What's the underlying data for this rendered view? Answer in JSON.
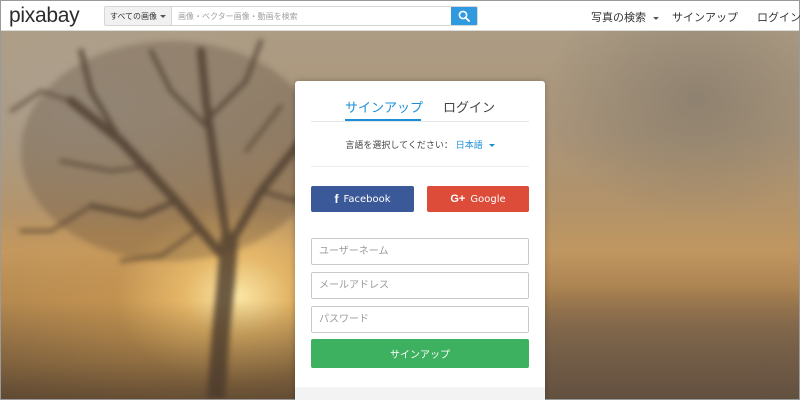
{
  "brand": {
    "logo_text": "pixabay"
  },
  "search": {
    "filter_label": "すべての画像",
    "placeholder": "画像・ベクター画像・動画を検索",
    "value": "",
    "button_icon": "search-icon"
  },
  "nav": {
    "photo_search": "写真の検索",
    "signup": "サインアップ",
    "login": "ログイン"
  },
  "panel": {
    "tabs": [
      {
        "label": "サインアップ",
        "active": true
      },
      {
        "label": "ログイン",
        "active": false
      }
    ],
    "language_prompt": "言語を選択してください：",
    "language_value": "日本語",
    "facebook_label": "Facebook",
    "google_label": "Google",
    "username_placeholder": "ユーザーネーム",
    "email_placeholder": "メールアドレス",
    "password_placeholder": "パスワード",
    "submit_label": "サインアップ"
  },
  "colors": {
    "accent": "#1a8fd8",
    "search_button": "#2f9ae0",
    "facebook": "#3b5998",
    "google": "#dd4b39",
    "submit": "#3db160"
  }
}
